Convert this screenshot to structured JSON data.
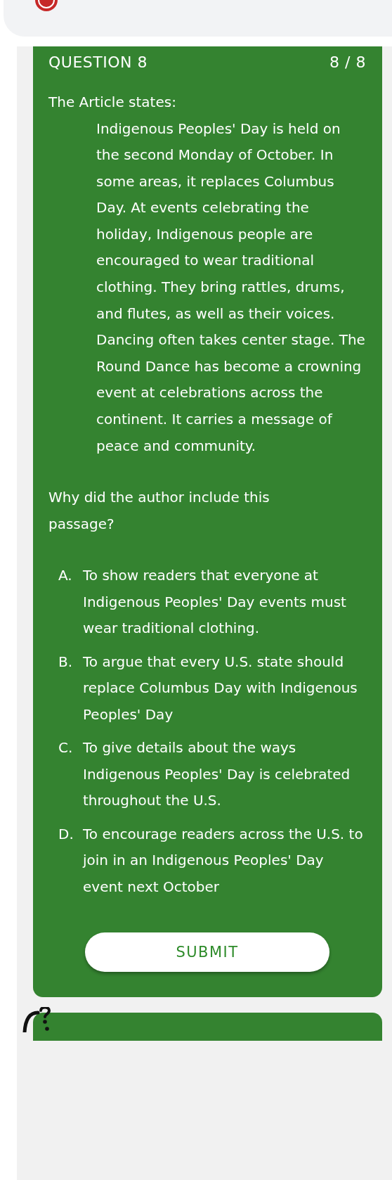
{
  "question_header": {
    "title": "QUESTION 8",
    "progress": "8 / 8"
  },
  "intro": "The Article states:",
  "passage": "Indigenous Peoples' Day is held on the second Monday of October. In some areas, it replaces Columbus Day. At events celebrating the holiday, Indigenous people are encouraged to wear traditional clothing. They bring rattles, drums, and flutes, as well as their voices. Dancing often takes center stage. The Round Dance has become a crowning event at celebrations across the continent. It carries a message of peace and community.",
  "prompt": "Why did the author include this passage?",
  "options": [
    {
      "letter": "A.",
      "text": "To show readers that everyone at Indigenous Peoples' Day events must wear traditional clothing.",
      "selected": false
    },
    {
      "letter": "B.",
      "text": "To argue that every U.S. state should replace Columbus Day with Indigenous Peoples' Day",
      "selected": false
    },
    {
      "letter": "C.",
      "text": "To give details about the ways Indigenous Peoples' Day is celebrated throughout the U.S.",
      "selected": false
    },
    {
      "letter": "D.",
      "text": "To encourage readers across the U.S. to join in an Indigenous Peoples' Day event next October",
      "selected": false
    }
  ],
  "submit": "SUBMIT"
}
